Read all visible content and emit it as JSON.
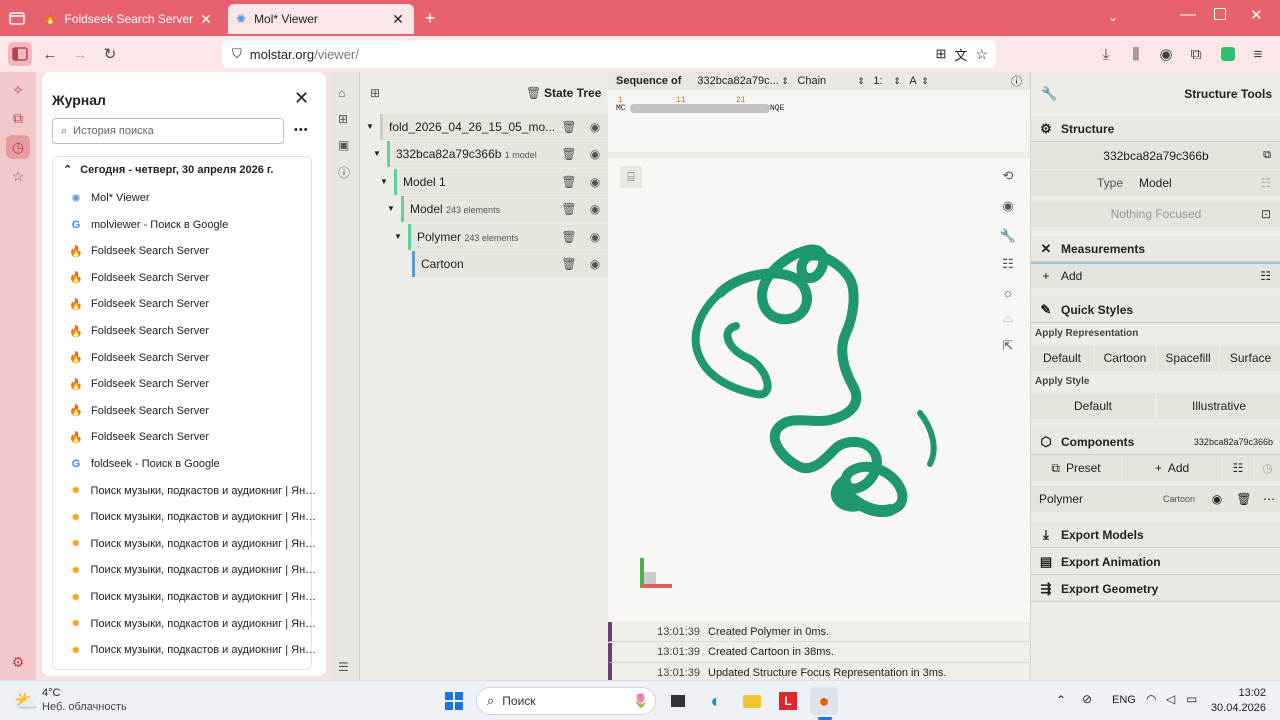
{
  "browser": {
    "tabs": [
      {
        "title": "Foldseek Search Server",
        "close": "✕"
      },
      {
        "title": "Mol* Viewer",
        "close": "✕"
      }
    ],
    "new_tab": "+",
    "url": {
      "host": "molstar.org",
      "path": "/viewer/"
    }
  },
  "history": {
    "title": "Журнал",
    "search_placeholder": "История поиска",
    "more": "•••",
    "group_label": "Сегодня - четверг, 30 апреля 2026 г.",
    "items": [
      {
        "icon": "molstar-icon",
        "label": "Mol* Viewer"
      },
      {
        "icon": "google-icon",
        "label": "molviewer - Поиск в Google"
      },
      {
        "icon": "foldseek-icon",
        "label": "Foldseek Search Server"
      },
      {
        "icon": "foldseek-icon",
        "label": "Foldseek Search Server"
      },
      {
        "icon": "foldseek-icon",
        "label": "Foldseek Search Server"
      },
      {
        "icon": "foldseek-icon",
        "label": "Foldseek Search Server"
      },
      {
        "icon": "foldseek-icon",
        "label": "Foldseek Search Server"
      },
      {
        "icon": "foldseek-icon",
        "label": "Foldseek Search Server"
      },
      {
        "icon": "foldseek-icon",
        "label": "Foldseek Search Server"
      },
      {
        "icon": "foldseek-icon",
        "label": "Foldseek Search Server"
      },
      {
        "icon": "google-icon",
        "label": "foldseek - Поиск в Google"
      },
      {
        "icon": "yandex-music-icon",
        "label": "Поиск музыки, подкастов и аудиокниг | Янде..."
      },
      {
        "icon": "yandex-music-icon",
        "label": "Поиск музыки, подкастов и аудиокниг | Янде..."
      },
      {
        "icon": "yandex-music-icon",
        "label": "Поиск музыки, подкастов и аудиокниг | Янде..."
      },
      {
        "icon": "yandex-music-icon",
        "label": "Поиск музыки, подкастов и аудиокниг | Янде..."
      },
      {
        "icon": "yandex-music-icon",
        "label": "Поиск музыки, подкастов и аудиокниг | Янде..."
      },
      {
        "icon": "yandex-music-icon",
        "label": "Поиск музыки, подкастов и аудиокниг | Янде..."
      },
      {
        "icon": "yandex-music-icon",
        "label": "Поиск музыки, подкастов и аудиокниг | Янде..."
      }
    ]
  },
  "state_tree": {
    "title": "State Tree",
    "nodes": [
      {
        "label": "fold_2026_04_26_15_05_mo...",
        "sub": "",
        "color": "#cfcbc2"
      },
      {
        "label": "332bca82a79c366b",
        "sub": "1 model",
        "color": "#5fd19a"
      },
      {
        "label": "Model 1",
        "sub": "",
        "color": "#5fd19a"
      },
      {
        "label": "Model",
        "sub": "243 elements",
        "color": "#5fd19a"
      },
      {
        "label": "Polymer",
        "sub": "243 elements",
        "color": "#5fd19a"
      },
      {
        "label": "Cartoon",
        "sub": "",
        "color": "#5b9bd5"
      }
    ]
  },
  "sequence": {
    "label": "Sequence of",
    "entity": "332bca82a79c...",
    "chain_label": "Chain",
    "chain_num": "1:",
    "chain_id": "A",
    "ruler": [
      "1",
      "11",
      "21"
    ],
    "start": "MC",
    "end": "NQE"
  },
  "log": [
    {
      "time": "13:01:39",
      "msg": "Created Polymer in 0ms."
    },
    {
      "time": "13:01:39",
      "msg": "Created Cartoon in 38ms."
    },
    {
      "time": "13:01:39",
      "msg": "Updated Structure Focus Representation in 3ms."
    }
  ],
  "tools": {
    "title": "Structure Tools",
    "structure": {
      "header": "Structure",
      "name": "332bca82a79c366b",
      "type_label": "Type",
      "type_value": "Model",
      "focus": "Nothing Focused"
    },
    "measurements": {
      "header": "Measurements",
      "add": "Add"
    },
    "quick_styles": {
      "header": "Quick Styles",
      "apply_repr": "Apply Representation",
      "repr": [
        "Default",
        "Cartoon",
        "Spacefill",
        "Surface"
      ],
      "apply_style": "Apply Style",
      "styles": [
        "Default",
        "Illustrative"
      ]
    },
    "components": {
      "header": "Components",
      "id": "332bca82a79c366b",
      "preset": "Preset",
      "add": "Add",
      "polymer": "Polymer",
      "polymer_repr": "Cartoon"
    },
    "exports": [
      "Export Models",
      "Export Animation",
      "Export Geometry"
    ]
  },
  "taskbar": {
    "weather_temp": "4°C",
    "weather_desc": "Неб. облачность",
    "search": "Поиск",
    "lang": "ENG",
    "time": "13:02",
    "date": "30.04.2026"
  },
  "colors": {
    "accent": "#e7626c",
    "protein": "#1f9872",
    "tree_bar": "#5fd19a"
  }
}
